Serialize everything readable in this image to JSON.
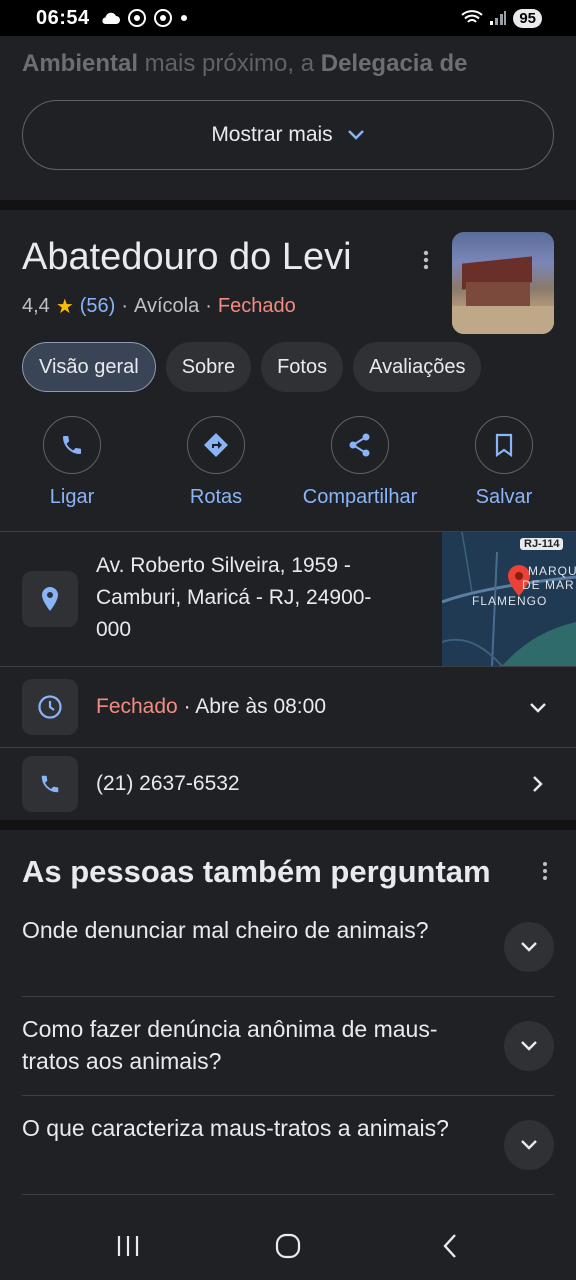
{
  "status_bar": {
    "time": "06:54",
    "battery": "95",
    "left_icons": [
      "cloud-icon",
      "chrome-icon",
      "chrome-icon",
      "dot-icon"
    ],
    "right_icons": [
      "wifi-icon",
      "signal-icon"
    ]
  },
  "top_card": {
    "faded_line_1_bold_a": "Ambiental",
    "faded_line_1_mid": " mais próximo, a ",
    "faded_line_1_bold_b": "Delegacia de",
    "show_more_label": "Mostrar mais"
  },
  "place": {
    "title": "Abatedouro do Levi",
    "rating": "4,4",
    "review_count": "(56)",
    "category": "Avícola",
    "status": "Fechado",
    "separator": "·",
    "tabs": [
      {
        "label": "Visão geral",
        "active": true
      },
      {
        "label": "Sobre",
        "active": false
      },
      {
        "label": "Fotos",
        "active": false
      },
      {
        "label": "Avaliações",
        "active": false
      }
    ],
    "actions": [
      {
        "label": "Ligar",
        "icon": "phone-icon"
      },
      {
        "label": "Rotas",
        "icon": "directions-icon"
      },
      {
        "label": "Compartilhar",
        "icon": "share-icon"
      },
      {
        "label": "Salvar",
        "icon": "bookmark-icon"
      }
    ],
    "address_line_1": "Av. Roberto Silveira, 1959 -",
    "address_line_2": "Camburi, Maricá - RJ, 24900-",
    "address_line_3": "000",
    "map": {
      "road_label": "RJ-114",
      "area_label_1": "MARQU",
      "area_label_2": "DE MAR",
      "area_label_3": "FLAMENGO"
    },
    "hours_status": "Fechado",
    "hours_detail": "· Abre às 08:00",
    "phone": "(21) 2637-6532"
  },
  "paa": {
    "title": "As pessoas também perguntam",
    "questions": [
      {
        "text": "Onde denunciar mal cheiro de animais?"
      },
      {
        "text": "Como fazer denúncia anônima de maus-tratos aos animais?"
      },
      {
        "text": "O que caracteriza maus-tratos a animais?"
      }
    ]
  },
  "colors": {
    "background": "#202124",
    "link_blue": "#8ab4f8",
    "closed_red": "#f28b82",
    "star_yellow": "#fbbc04",
    "pin_red": "#ea4335"
  }
}
